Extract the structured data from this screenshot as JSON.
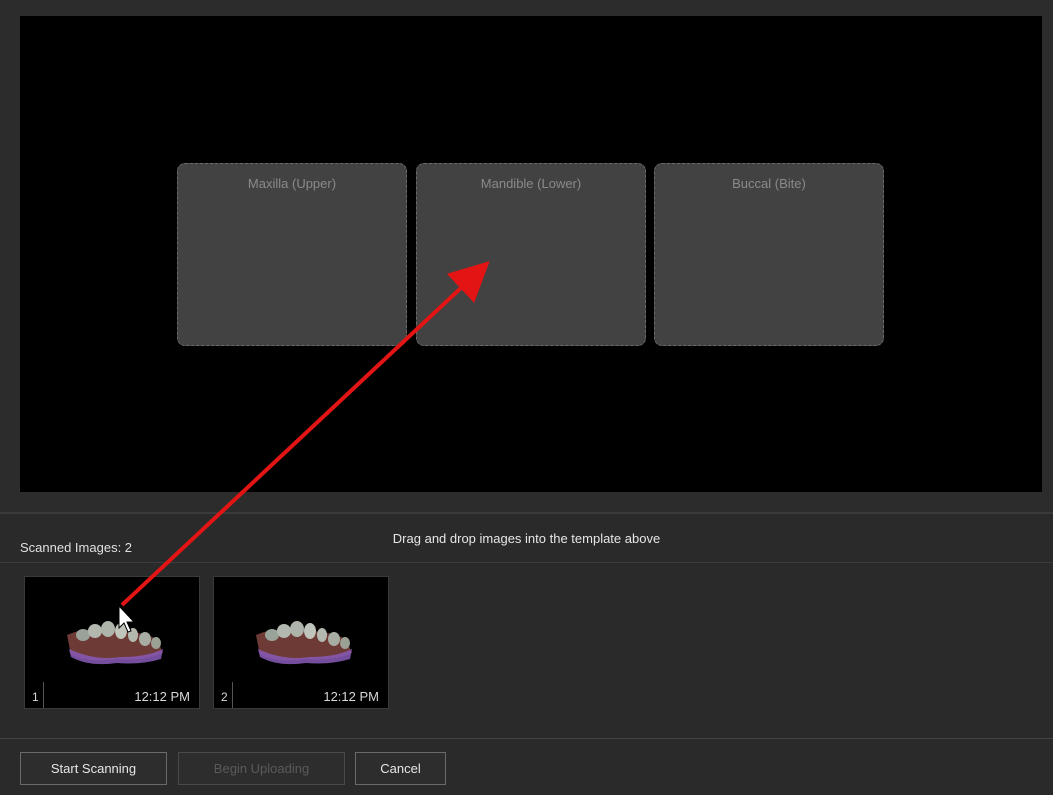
{
  "template": {
    "slots": [
      {
        "label": "Maxilla (Upper)"
      },
      {
        "label": "Mandible (Lower)"
      },
      {
        "label": "Buccal (Bite)"
      }
    ]
  },
  "tray": {
    "scan_count": "Scanned Images: 2",
    "instruction": "Drag and drop images into the template above",
    "images": [
      {
        "index": "1",
        "time": "12:12 PM"
      },
      {
        "index": "2",
        "time": "12:12 PM"
      }
    ]
  },
  "footer": {
    "start_scanning": "Start Scanning",
    "begin_uploading": "Begin Uploading",
    "cancel": "Cancel"
  },
  "colors": {
    "arrow": "#e31414",
    "viewport_bg": "#000000",
    "slot_bg": "#424242"
  },
  "icons": [
    "cursor-arrow-icon",
    "drag-arrow-annotation"
  ]
}
